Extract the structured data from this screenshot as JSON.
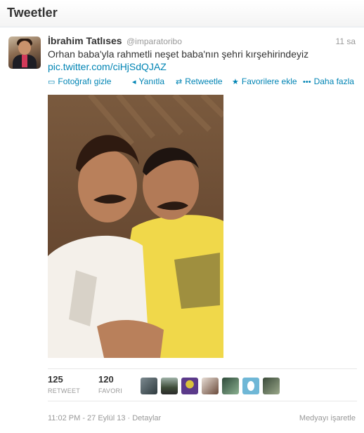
{
  "header": {
    "title": "Tweetler"
  },
  "tweet": {
    "name": "İbrahim Tatlıses",
    "screen_name": "@imparatoribo",
    "time_ago": "11 sa",
    "text": "Orhan baba'yla rahmetli neşet baba'nın şehri kırşehirindeyiz",
    "link": "pic.twitter.com/ciHjSdQJAZ"
  },
  "actions": {
    "hide_photo": "Fotoğrafı gizle",
    "reply": "Yanıtla",
    "retweet": "Retweetle",
    "favorite": "Favorilere ekle",
    "more": "Daha fazla"
  },
  "icons": {
    "hide_photo": "photo-icon",
    "reply": "reply-arrow-icon",
    "retweet": "retweet-icon",
    "favorite": "star-icon",
    "more": "ellipsis-icon"
  },
  "stats": {
    "retweets": {
      "count": "125",
      "label": "RETWEET"
    },
    "favorites": {
      "count": "120",
      "label": "FAVORI"
    }
  },
  "footer": {
    "timestamp": "11:02 PM - 27 Eylül 13 · Detaylar",
    "flag_media": "Medyayı işaretle"
  },
  "colors": {
    "link": "#0084b4",
    "muted": "#999999",
    "text": "#333333"
  }
}
